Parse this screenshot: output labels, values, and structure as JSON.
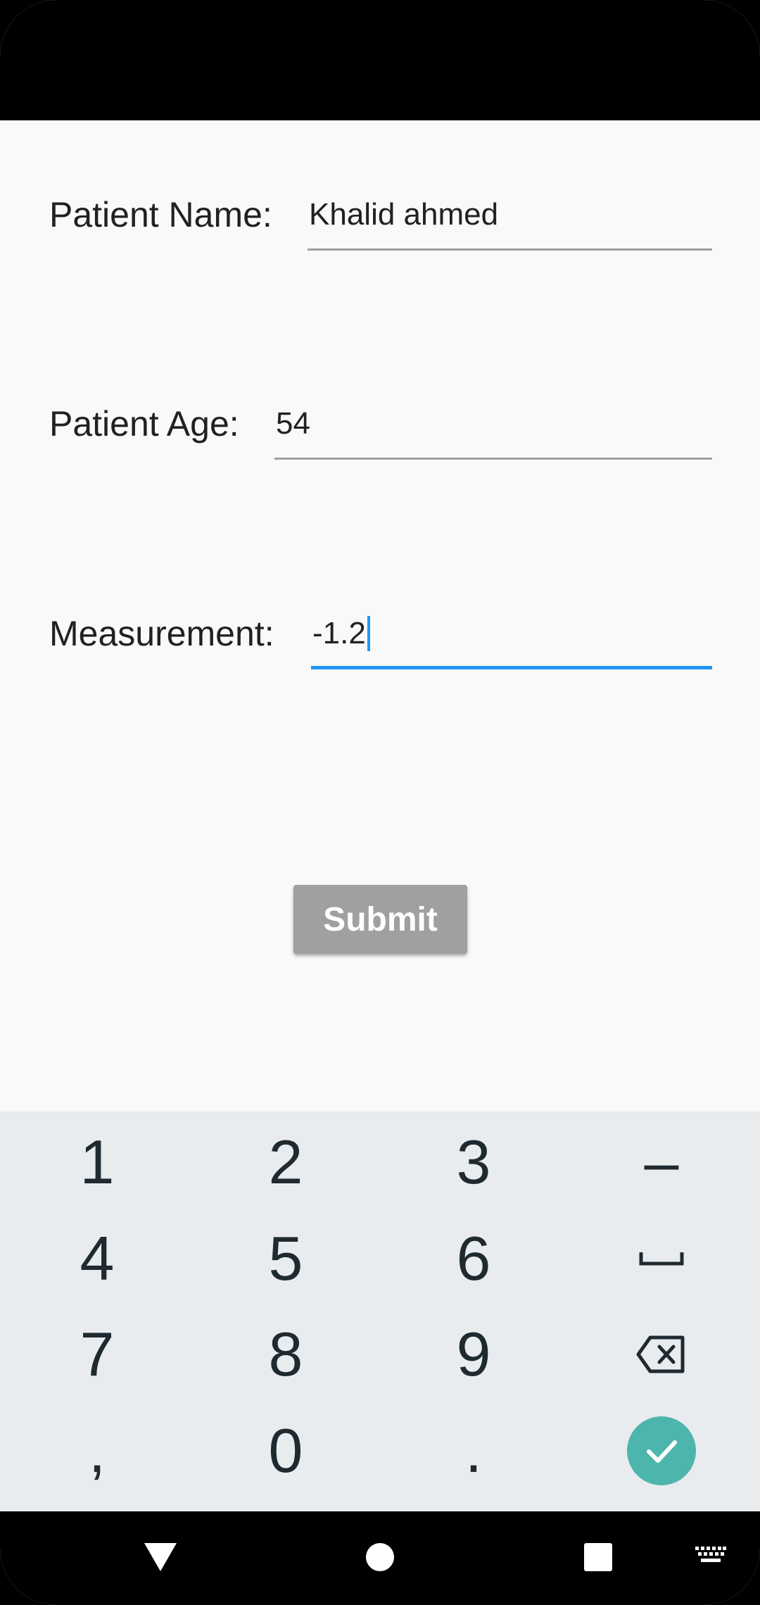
{
  "form": {
    "patient_name": {
      "label": "Patient Name:",
      "value": "Khalid ahmed"
    },
    "patient_age": {
      "label": "Patient Age:",
      "value": "54"
    },
    "measurement": {
      "label": "Measurement:",
      "value": "-1.2"
    },
    "submit_label": "Submit"
  },
  "keyboard": {
    "keys": [
      "1",
      "2",
      "3",
      "–",
      "4",
      "5",
      "6",
      "space",
      "7",
      "8",
      "9",
      "backspace",
      ",",
      "0",
      ".",
      "done"
    ],
    "labels": {
      "k1": "1",
      "k2": "2",
      "k3": "3",
      "kdash": "–",
      "k4": "4",
      "k5": "5",
      "k6": "6",
      "k7": "7",
      "k8": "8",
      "k9": "9",
      "kcomma": ",",
      "k0": "0",
      "kdot": "."
    },
    "done_color": "#4db6ac"
  },
  "nav": {
    "icons": [
      "back-icon",
      "home-icon",
      "recents-icon",
      "keyboard-switch-icon"
    ]
  },
  "colors": {
    "accent": "#2196f3",
    "button_disabled": "#a0a0a0",
    "background": "#f9f9f9",
    "keyboard_bg": "#e9ecef"
  }
}
